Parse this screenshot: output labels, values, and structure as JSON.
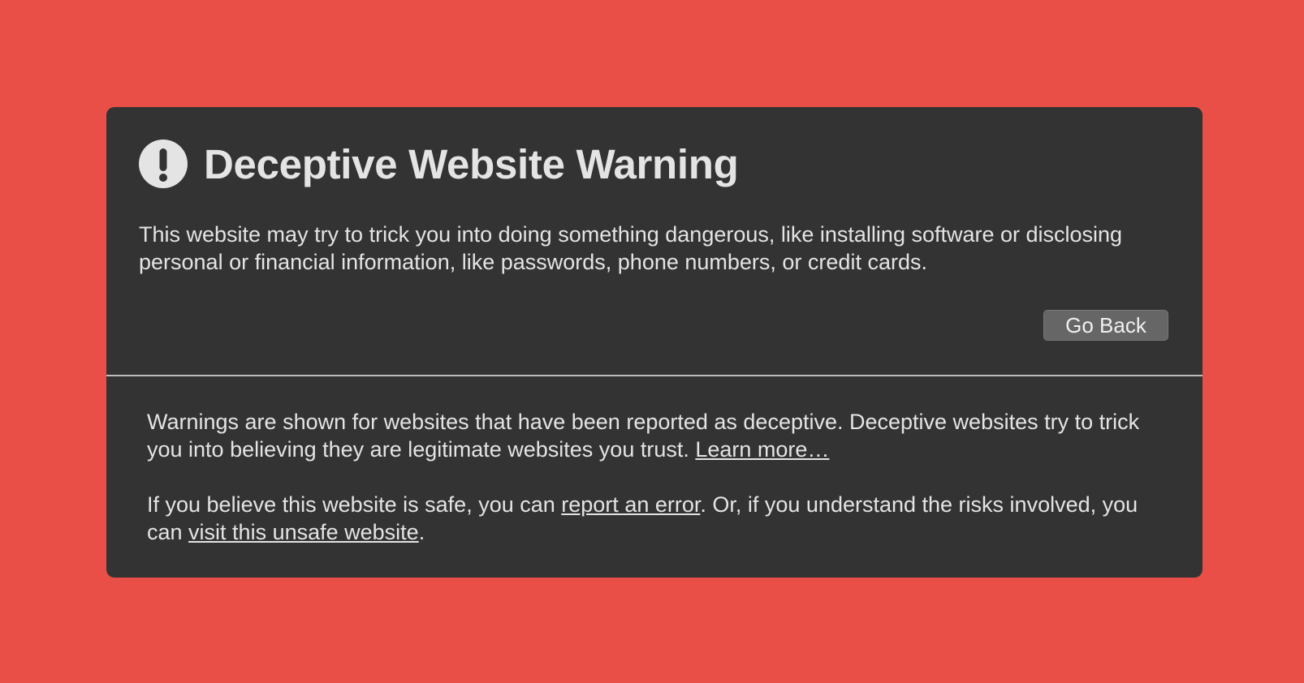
{
  "colors": {
    "page_background": "#e94f47",
    "card_background": "#333333",
    "text": "#e4e4e4",
    "button_background": "#666666"
  },
  "warning": {
    "icon": "exclamation-circle-icon",
    "title": "Deceptive Website Warning",
    "description": "This website may try to trick you into doing something dangerous, like installing software or disclosing personal or financial information, like passwords, phone numbers, or credit cards.",
    "go_back_label": "Go Back"
  },
  "details": {
    "para1_text": "Warnings are shown for websites that have been reported as deceptive. Deceptive websites try to trick you into believing they are legitimate websites you trust. ",
    "learn_more_label": "Learn more…",
    "para2_text_a": "If you believe this website is safe, you can ",
    "report_error_label": "report an error",
    "para2_text_b": ". Or, if you understand the risks involved, you can ",
    "visit_unsafe_label": "visit this unsafe website",
    "para2_text_c": "."
  }
}
